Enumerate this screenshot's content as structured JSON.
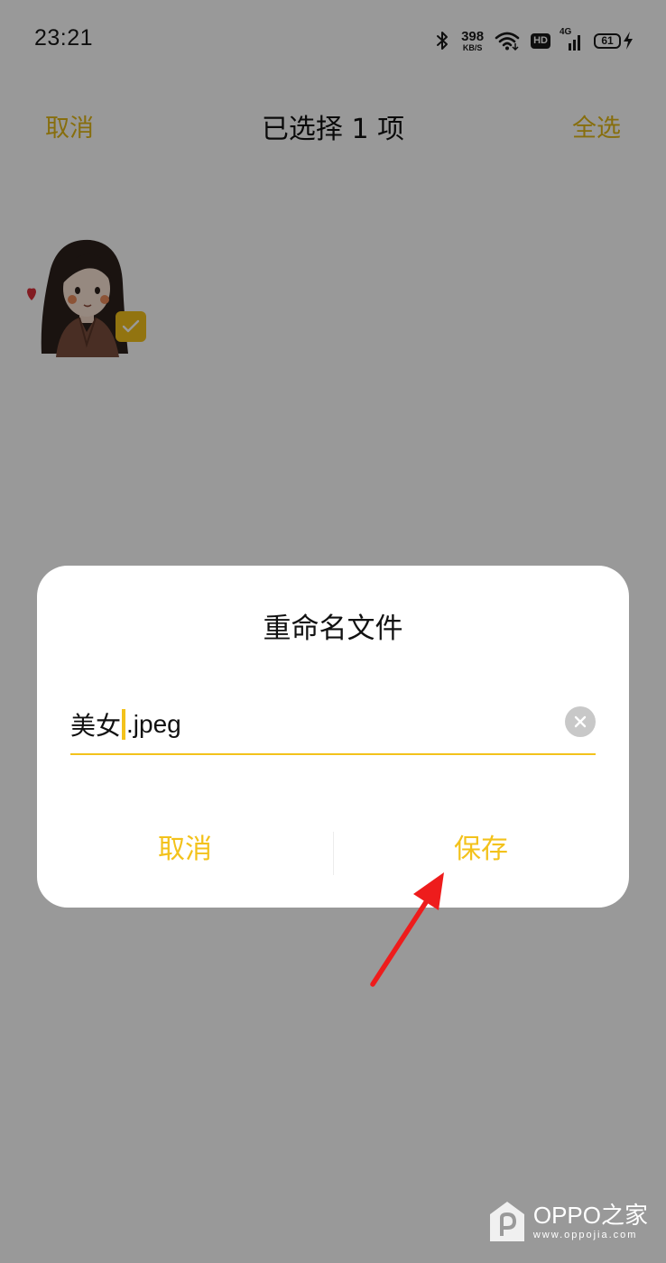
{
  "status_bar": {
    "time": "23:21",
    "net_speed_value": "398",
    "net_speed_unit": "KB/S",
    "hd_label": "HD",
    "cellular_label": "4G",
    "battery_level": "61",
    "icons": [
      "bluetooth-icon",
      "wifi-icon",
      "cellular-signal-icon",
      "charging-icon"
    ]
  },
  "action_bar": {
    "cancel_label": "取消",
    "title": "已选择 1 项",
    "select_all_label": "全选"
  },
  "thumbnail": {
    "selected": true,
    "check_icon": "check-icon"
  },
  "rename_dialog": {
    "title": "重命名文件",
    "filename_base": "美女",
    "filename_ext": ".jpeg",
    "cancel_label": "取消",
    "save_label": "保存"
  },
  "annotation": {
    "arrow_color": "#ee1c1c"
  },
  "watermark": {
    "name": "OPPO之家",
    "url": "www.oppojia.com"
  },
  "colors": {
    "accent": "#f3c21b",
    "dialog_background": "#ffffff",
    "overlay": "rgba(0,0,0,0.4)"
  }
}
